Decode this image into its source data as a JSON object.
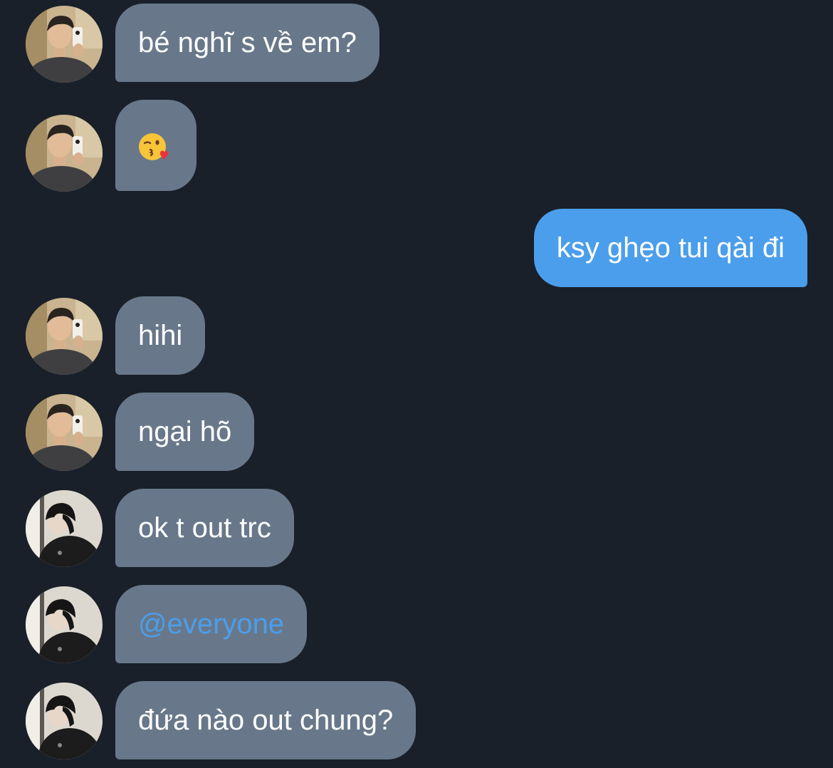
{
  "messages": [
    {
      "id": "m1",
      "direction": "incoming",
      "avatar": "avatar-a",
      "text": "bé nghĩ s về em?"
    },
    {
      "id": "m2",
      "direction": "incoming",
      "avatar": "avatar-a",
      "text": "",
      "emoji": "kissing-heart-emoji"
    },
    {
      "id": "m3",
      "direction": "outgoing",
      "text": "ksy ghẹo tui qài đi"
    },
    {
      "id": "m4",
      "direction": "incoming",
      "avatar": "avatar-a",
      "text": "hihi"
    },
    {
      "id": "m5",
      "direction": "incoming",
      "avatar": "avatar-a",
      "text": "ngại hõ"
    },
    {
      "id": "m6",
      "direction": "incoming",
      "avatar": "avatar-b",
      "text": "ok t out trc"
    },
    {
      "id": "m7",
      "direction": "incoming",
      "avatar": "avatar-b",
      "text": "@everyone",
      "mention": true
    },
    {
      "id": "m8",
      "direction": "incoming",
      "avatar": "avatar-b",
      "text": "đứa nào out chung?"
    }
  ],
  "colors": {
    "background": "#19202a",
    "incoming_bubble": "#68788a",
    "outgoing_bubble": "#4b9eeb",
    "mention_text": "#4b9eeb",
    "text": "#ffffff"
  }
}
